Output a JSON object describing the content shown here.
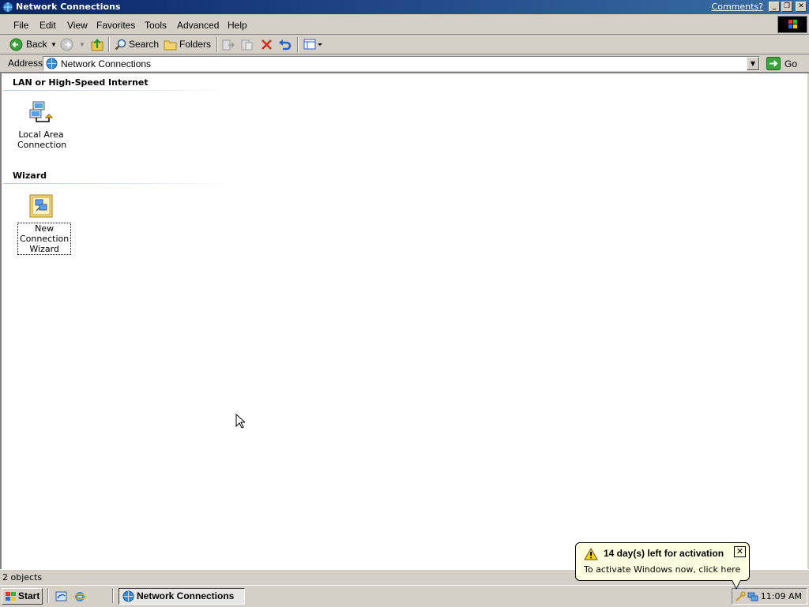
{
  "window": {
    "title": "Network Connections",
    "comments_link": "Comments?",
    "minimize": "_",
    "restore": "❐",
    "close": "✕"
  },
  "menu": {
    "items": [
      "File",
      "Edit",
      "View",
      "Favorites",
      "Tools",
      "Advanced",
      "Help"
    ]
  },
  "toolbar": {
    "back_label": "Back",
    "search_label": "Search",
    "folders_label": "Folders"
  },
  "address": {
    "label": "Address",
    "value": "Network Connections",
    "go_label": "Go"
  },
  "groups": [
    {
      "heading": "LAN or High-Speed Internet",
      "items": [
        {
          "label_lines": [
            "Local Area",
            "Connection"
          ],
          "icon": "network-connection-icon"
        }
      ]
    },
    {
      "heading": "Wizard",
      "items": [
        {
          "label_lines": [
            "New",
            "Connection",
            "Wizard"
          ],
          "icon": "wizard-icon"
        }
      ]
    }
  ],
  "status": {
    "text": "2 objects"
  },
  "taskbar": {
    "start_label": "Start",
    "task_label": "Network Connections",
    "clock": "11:09 AM"
  },
  "balloon": {
    "title": "14 day(s) left for activation",
    "text": "To activate Windows now, click here",
    "close": "✕"
  },
  "colors": {
    "titlebar_start": "#0a246a",
    "titlebar_end": "#3a6ea5",
    "chrome": "#d4d0c8",
    "balloon_bg": "#ffffe1"
  }
}
